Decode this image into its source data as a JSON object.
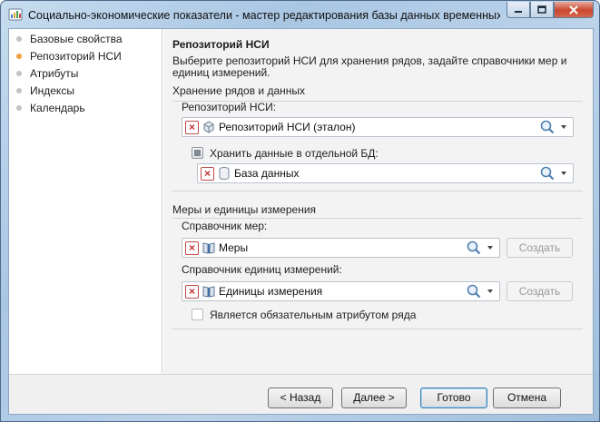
{
  "window": {
    "title": "Социально-экономические показатели - мастер редактирования базы данных временных р..."
  },
  "sidebar": {
    "items": [
      {
        "label": "Базовые свойства",
        "active": false
      },
      {
        "label": "Репозиторий НСИ",
        "active": true
      },
      {
        "label": "Атрибуты",
        "active": false
      },
      {
        "label": "Индексы",
        "active": false
      },
      {
        "label": "Календарь",
        "active": false
      }
    ]
  },
  "main": {
    "heading": "Репозиторий НСИ",
    "description": "Выберите репозиторий НСИ для хранения рядов, задайте справочники мер и единиц измерений.",
    "storage_group": {
      "title": "Хранение рядов и данных",
      "repo_label": "Репозиторий НСИ:",
      "repo_value": "Репозиторий НСИ (эталон)",
      "separate_db_label": "Хранить данные в отдельной БД:",
      "separate_db_state": "indeterminate",
      "db_value": "База данных"
    },
    "measures_group": {
      "title": "Меры и единицы измерения",
      "measures_label": "Справочник мер:",
      "measures_value": "Меры",
      "units_label": "Справочник единиц измерений:",
      "units_value": "Единицы измерения",
      "create_label": "Создать",
      "required_attr_label": "Является обязательным атрибутом ряда",
      "required_attr_checked": false
    }
  },
  "footer": {
    "back": "< Назад",
    "next": "Далее >",
    "finish": "Готово",
    "cancel": "Отмена"
  },
  "colors": {
    "active_step_dot": "#f0a040",
    "close_button": "#c9472e",
    "remove_x": "#c23030"
  }
}
